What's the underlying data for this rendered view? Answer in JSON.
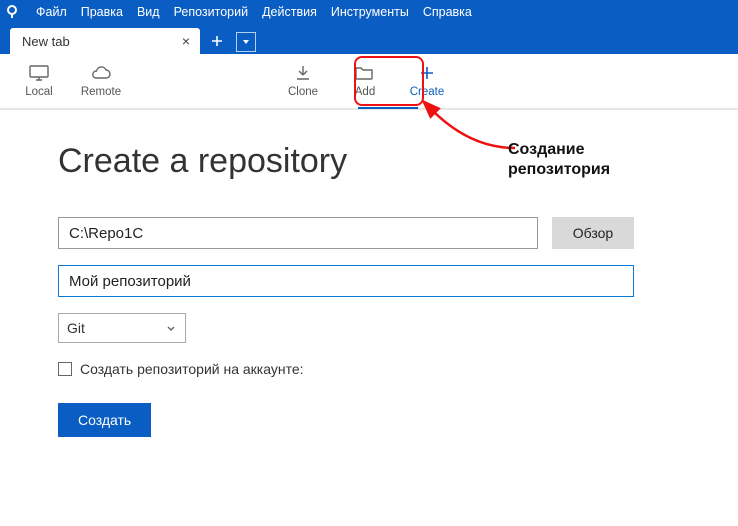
{
  "menu": {
    "file": "Файл",
    "edit": "Правка",
    "view": "Вид",
    "repository": "Репозиторий",
    "actions": "Действия",
    "tools": "Инструменты",
    "help": "Справка"
  },
  "tab": {
    "label": "New tab"
  },
  "toolbar": {
    "local": "Local",
    "remote": "Remote",
    "clone": "Clone",
    "add": "Add",
    "create": "Create"
  },
  "annotation": {
    "line1": "Создание",
    "line2": "репозитория"
  },
  "form": {
    "heading": "Create a repository",
    "path_value": "C:\\Repo1C",
    "browse_label": "Обзор",
    "name_value": "Мой репозиторий",
    "vcs_selected": "Git",
    "checkbox_label": "Создать репозиторий на аккаунте:",
    "submit_label": "Создать"
  }
}
